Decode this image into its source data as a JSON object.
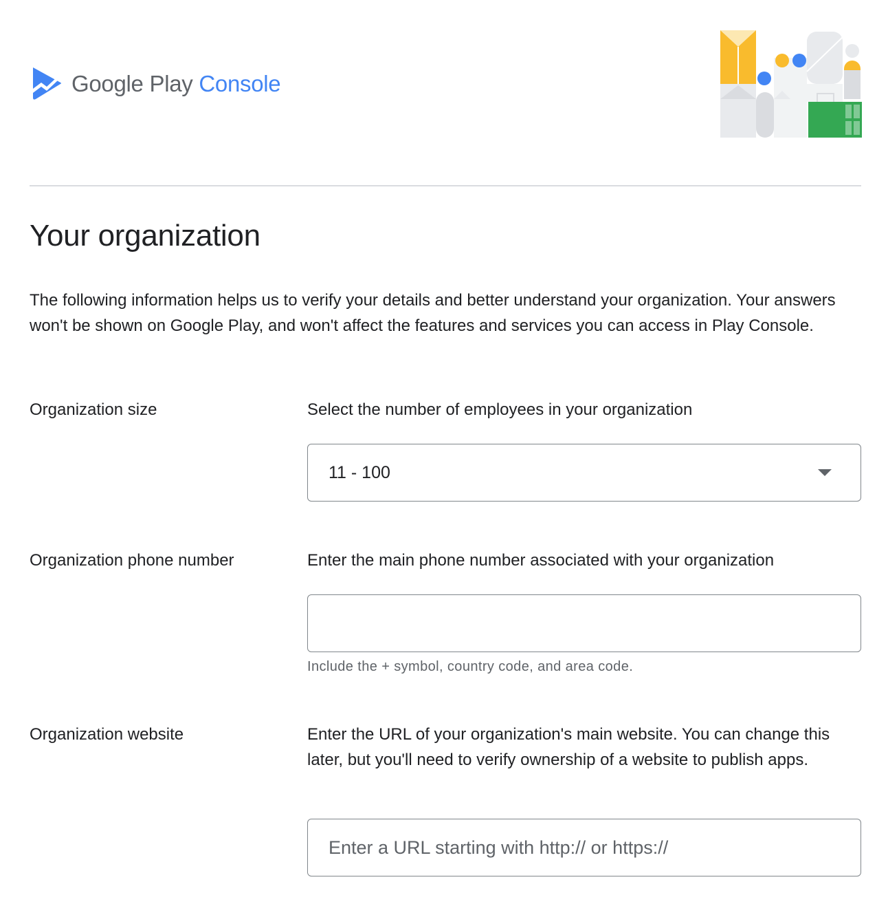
{
  "header": {
    "brand_google_play": "Google Play",
    "brand_console": "Console"
  },
  "page": {
    "title": "Your organization",
    "intro": "The following information helps us to verify your details and better understand your organization. Your answers won't be shown on Google Play, and won't affect the features and services you can access in Play Console."
  },
  "org_size": {
    "label": "Organization size",
    "description": "Select the number of employees in your organization",
    "selected": "11 - 100"
  },
  "org_phone": {
    "label": "Organization phone number",
    "description": "Enter the main phone number associated with your organization",
    "value": "",
    "hint": "Include the + symbol, country code, and area code."
  },
  "org_website": {
    "label": "Organization website",
    "description": "Enter the URL of your organization's main website. You can change this later, but you'll need to verify ownership of a website to publish apps.",
    "value": "",
    "placeholder": "Enter a URL starting with http:// or https://"
  },
  "icons": {
    "logo": "play-console-logo-icon",
    "dropdown": "dropdown-caret-icon",
    "illustration": "header-illustration"
  },
  "colors": {
    "brand_blue": "#4285f4",
    "text": "#202124",
    "secondary_text": "#5f6368",
    "border": "#80868b"
  }
}
